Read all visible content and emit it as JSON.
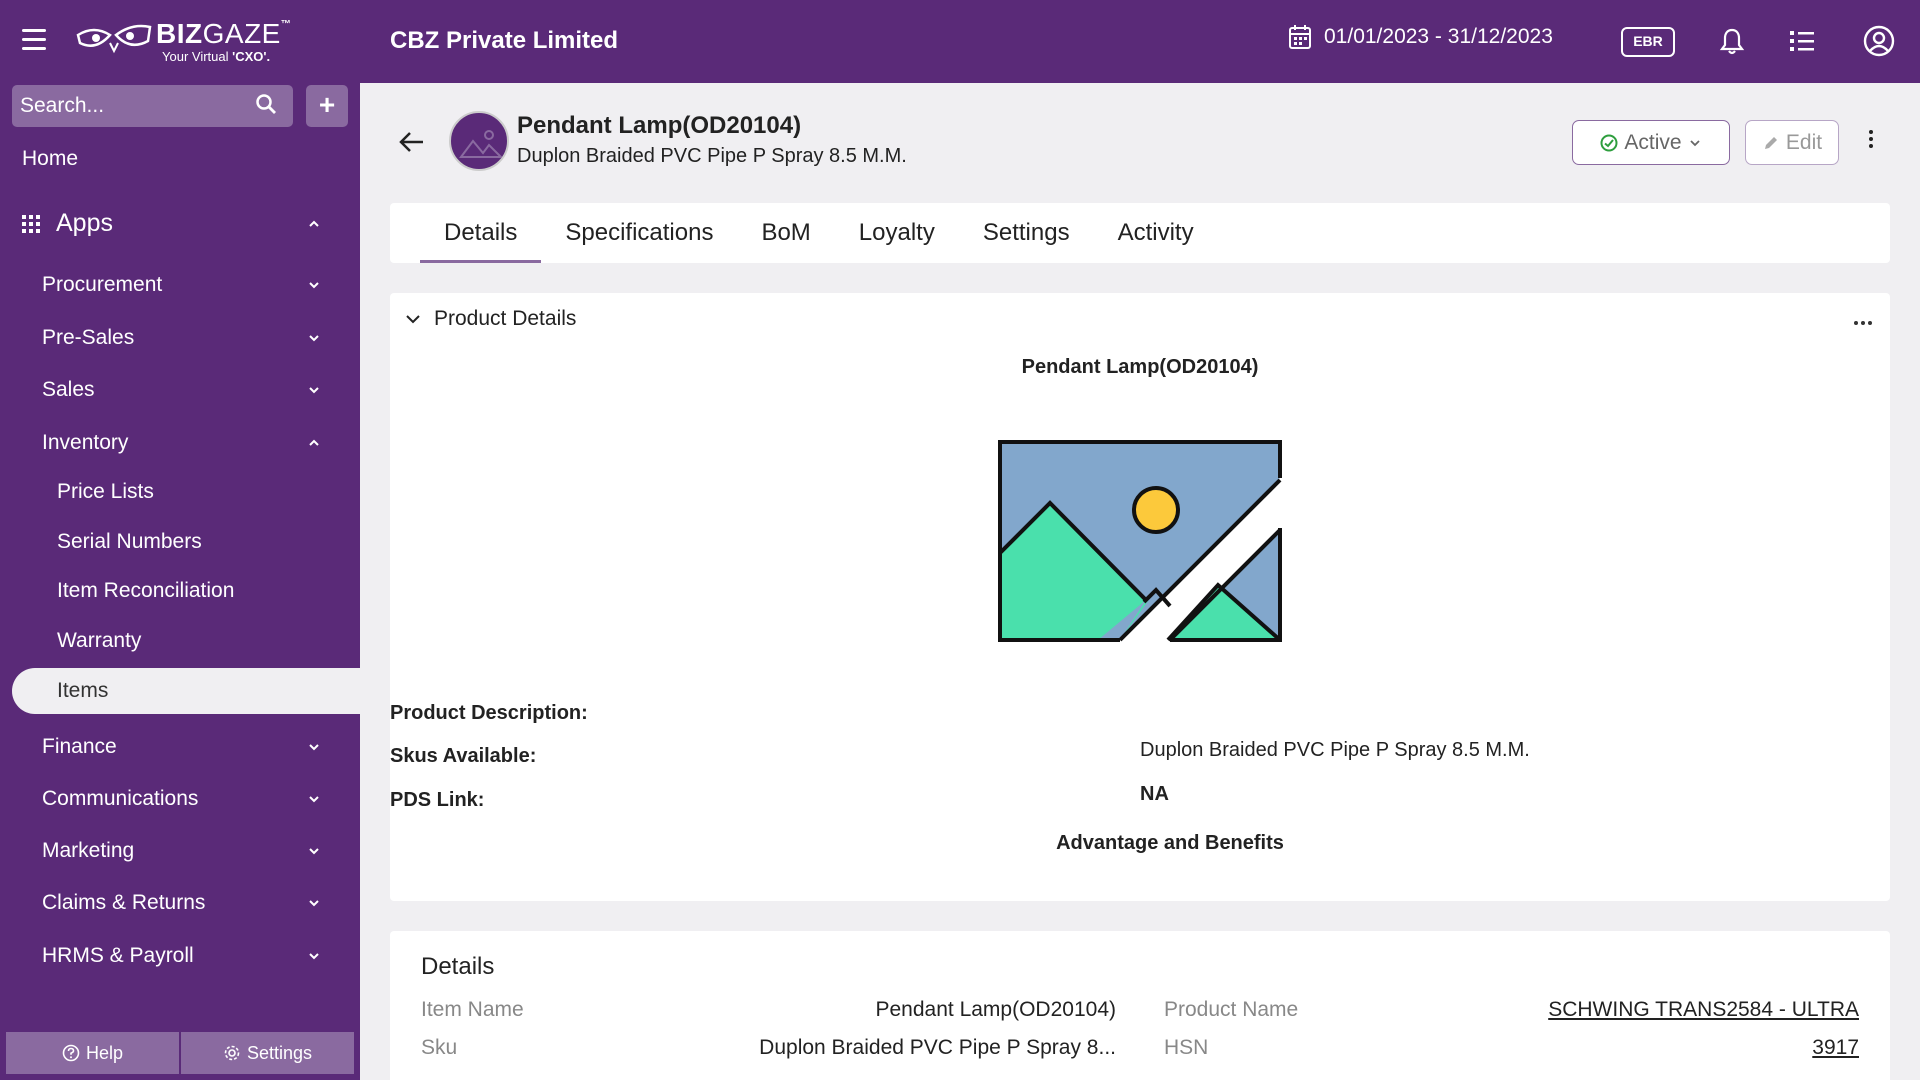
{
  "topbar": {
    "logo_main_bold": "BIZ",
    "logo_main_thin": "GAZE",
    "logo_tm": "™",
    "logo_sub_prefix": "Your Virtual ",
    "logo_sub_bold": "'CXO'.",
    "company": "CBZ Private Limited",
    "date_range": "01/01/2023 - 31/12/2023",
    "ebr_badge": "EBR",
    "icons": [
      "menu-icon",
      "calendar-icon",
      "bell-icon",
      "list-icon",
      "user-circle-icon"
    ]
  },
  "sidebar": {
    "search_placeholder": "Search...",
    "add_label": "+",
    "home": "Home",
    "apps": "Apps",
    "items": [
      {
        "label": "Procurement",
        "expanded": false
      },
      {
        "label": "Pre-Sales",
        "expanded": false
      },
      {
        "label": "Sales",
        "expanded": false
      },
      {
        "label": "Inventory",
        "expanded": true
      }
    ],
    "inventory_sub": [
      "Price Lists",
      "Serial Numbers",
      "Item Reconciliation",
      "Warranty"
    ],
    "active_item": "Items",
    "items_after": [
      {
        "label": "Finance"
      },
      {
        "label": "Communications"
      },
      {
        "label": "Marketing"
      },
      {
        "label": "Claims & Returns"
      },
      {
        "label": "HRMS & Payroll"
      }
    ],
    "footer_help": "Help",
    "footer_settings": "Settings"
  },
  "header": {
    "title": "Pendant Lamp(OD20104)",
    "subtitle": "Duplon Braided PVC Pipe P Spray 8.5 M.M.",
    "status": "Active",
    "edit": "Edit"
  },
  "tabs": [
    {
      "label": "Details",
      "active": true
    },
    {
      "label": "Specifications",
      "active": false
    },
    {
      "label": "BoM",
      "active": false
    },
    {
      "label": "Loyalty",
      "active": false
    },
    {
      "label": "Settings",
      "active": false
    },
    {
      "label": "Activity",
      "active": false
    }
  ],
  "product_details": {
    "section_title": "Product Details",
    "product_title": "Pendant Lamp(OD20104)",
    "description_label": "Product Description:",
    "skus_label": "Skus Available:",
    "skus_value": "Duplon Braided PVC Pipe P Spray 8.5 M.M.",
    "pds_label": "PDS Link:",
    "pds_value": "NA",
    "advantages": "Advantage and Benefits"
  },
  "details": {
    "title": "Details",
    "rows": [
      {
        "label": "Item Name",
        "value": "Pendant Lamp(OD20104)",
        "label2": "Product Name",
        "value2": "SCHWING TRANS2584 - ULTRA"
      },
      {
        "label": "Sku",
        "value": "Duplon Braided PVC Pipe P Spray 8...",
        "label2": "HSN",
        "value2": "3917"
      }
    ]
  },
  "colors": {
    "brand": "#5a2a78",
    "brand_light": "#8a6aa0",
    "active_green": "#2e9e3e"
  }
}
